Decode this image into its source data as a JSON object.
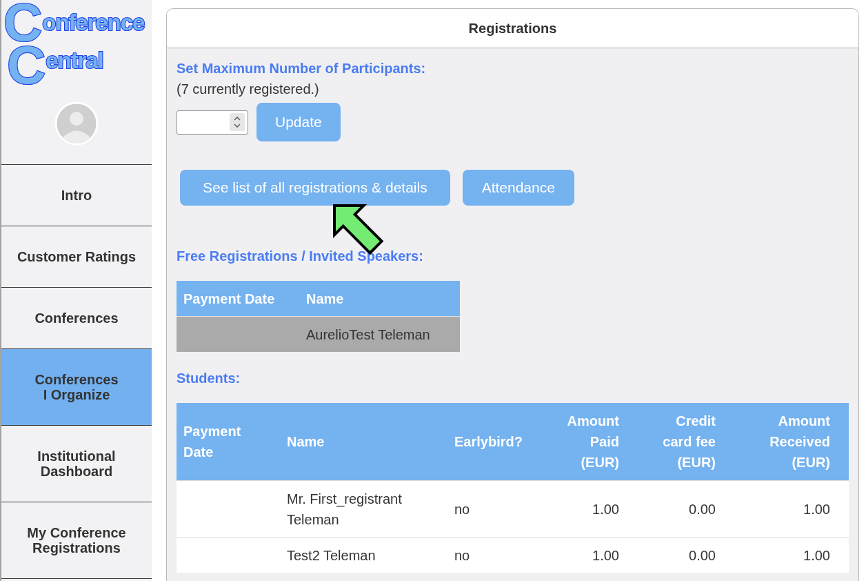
{
  "sidebar": {
    "logo": {
      "lines": [
        "Conference",
        "Central"
      ]
    },
    "items": [
      {
        "label": "Intro",
        "selected": false
      },
      {
        "label": "Customer Ratings",
        "selected": false
      },
      {
        "label": "Conferences",
        "selected": false
      },
      {
        "label": "Conferences\nI Organize",
        "selected": true
      },
      {
        "label": "Institutional Dashboard",
        "selected": false
      },
      {
        "label": "My Conference Registrations",
        "selected": false
      }
    ]
  },
  "panel": {
    "title": "Registrations",
    "max_participants": {
      "heading": "Set Maximum Number of Participants:",
      "note": "(7 currently registered.)",
      "button": "Update"
    },
    "actions": [
      "See list of all registrations & details",
      "Attendance"
    ],
    "free_registrations": {
      "heading": "Free Registrations / Invited Speakers:",
      "columns": [
        {
          "label": "Payment Date"
        },
        {
          "label": "Name"
        }
      ],
      "rows": [
        {
          "name": "AurelioTest Teleman"
        }
      ]
    },
    "students": {
      "heading": "Students:",
      "columns": [
        {
          "label": "Payment Date",
          "kind": "text"
        },
        {
          "label": "Name",
          "kind": "text"
        },
        {
          "label": "Earlybird?",
          "kind": "text"
        },
        {
          "label": "Amount Paid (EUR)",
          "kind": "amount"
        },
        {
          "label": "Credit card fee (EUR)",
          "kind": "amount"
        },
        {
          "label": "Amount Received (EUR)",
          "kind": "amount"
        }
      ],
      "rows": [
        {
          "name": "Mr. First_registrant Teleman",
          "earlybird": "no",
          "amount_paid": "1.00",
          "credit_card_fee": "0.00",
          "amount_received": "1.00"
        },
        {
          "name": "Test2 Teleman",
          "earlybird": "no",
          "amount_paid": "1.00",
          "credit_card_fee": "0.00",
          "amount_received": "1.00"
        }
      ]
    }
  }
}
